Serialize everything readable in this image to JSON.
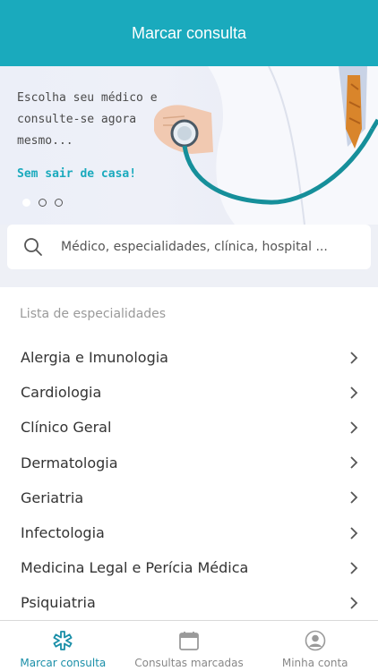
{
  "header": {
    "title": "Marcar consulta"
  },
  "banner": {
    "text": "Escolha seu médico e consulte-se agora mesmo...",
    "cta": "Sem sair de casa!",
    "slides": 3,
    "active_slide": 0
  },
  "search": {
    "placeholder": "Médico, especialidades, clínica, hospital ..."
  },
  "specialties": {
    "section_label": "Lista de especialidades",
    "items": [
      {
        "label": "Alergia e Imunologia"
      },
      {
        "label": "Cardiologia"
      },
      {
        "label": "Clínico Geral"
      },
      {
        "label": "Dermatologia"
      },
      {
        "label": "Geriatria"
      },
      {
        "label": "Infectologia"
      },
      {
        "label": "Medicina Legal e Perícia Médica"
      },
      {
        "label": "Psiquiatria"
      }
    ]
  },
  "tabbar": {
    "tabs": [
      {
        "label": "Marcar consulta",
        "icon": "medical-asterisk-icon",
        "active": true
      },
      {
        "label": "Consultas marcadas",
        "icon": "calendar-icon",
        "active": false
      },
      {
        "label": "Minha conta",
        "icon": "user-account-icon",
        "active": false
      }
    ]
  },
  "colors": {
    "primary": "#1aaabd",
    "active_tab": "#1a8fa8"
  }
}
